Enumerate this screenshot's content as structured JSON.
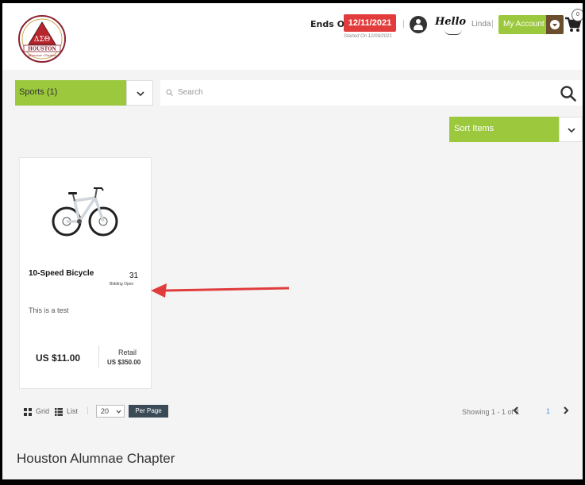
{
  "header": {
    "logo_text": [
      "ΔΣΘ",
      "HOUSTON",
      "Alumnae Chapter"
    ],
    "ends_label": "Ends On",
    "ends_date": "12/11/2021",
    "started": "Started On 12/09/2021",
    "hello": "Hello",
    "user_name": "Linda",
    "my_account": "My Account",
    "cart_count": "0",
    "separator": "|"
  },
  "filters": {
    "category": "Sports  (1)",
    "search_placeholder": "Search",
    "sort_label": "Sort Items"
  },
  "product": {
    "name": "10-Speed Bicycle",
    "bid_count": "31",
    "bid_status": "Bidding Open",
    "description": "This is a test",
    "price": "US $11.00",
    "retail_label": "Retail",
    "retail_value": "US $350.00"
  },
  "toolbar": {
    "grid_label": "Grid",
    "list_label": "List",
    "per_page_value": "20",
    "per_page_button": "Per Page",
    "showing": "Showing 1 - 1 of 1",
    "page": "1",
    "separator": "|"
  },
  "footer": {
    "chapter_name": "Houston Alumnae Chapter"
  },
  "colors": {
    "accent_green": "#9bc83c",
    "date_red": "#e23b3b",
    "account_brown": "#6b4e2e",
    "button_slate": "#3a4b57",
    "annotation_arrow": "#e03c3c"
  }
}
